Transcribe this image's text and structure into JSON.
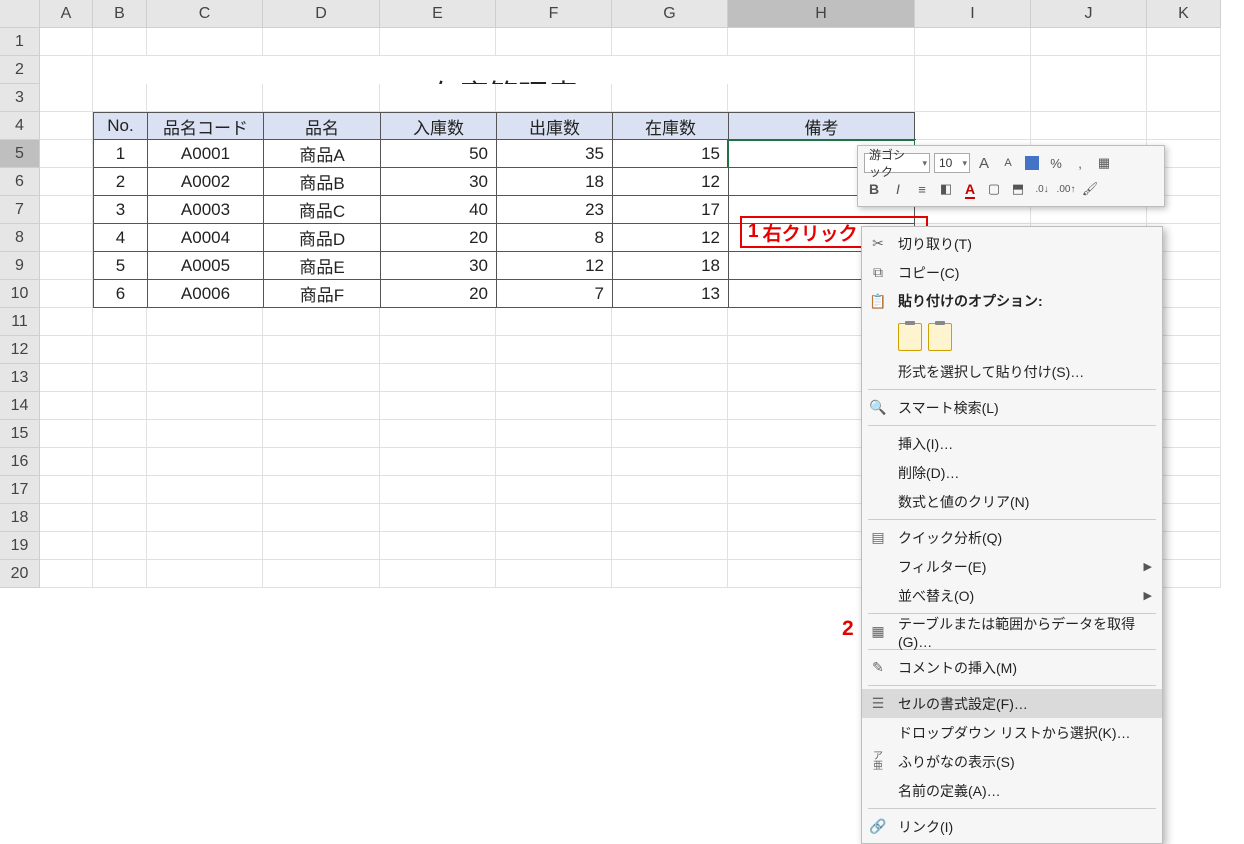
{
  "cols": [
    "A",
    "B",
    "C",
    "D",
    "E",
    "F",
    "G",
    "H",
    "I",
    "J",
    "K"
  ],
  "rows": [
    "1",
    "2",
    "3",
    "4",
    "5",
    "6",
    "7",
    "8",
    "9",
    "10",
    "11",
    "12",
    "13",
    "14",
    "15",
    "16",
    "17",
    "18",
    "19",
    "20"
  ],
  "title": "在庫管理表",
  "activeCol": "H",
  "activeRow": "5",
  "tableHeaders": [
    "No.",
    "品名コード",
    "品名",
    "入庫数",
    "出庫数",
    "在庫数",
    "備考"
  ],
  "tableRows": [
    {
      "no": "1",
      "code": "A0001",
      "name": "商品A",
      "in": "50",
      "out": "35",
      "stock": "15",
      "note": ""
    },
    {
      "no": "2",
      "code": "A0002",
      "name": "商品B",
      "in": "30",
      "out": "18",
      "stock": "12",
      "note": ""
    },
    {
      "no": "3",
      "code": "A0003",
      "name": "商品C",
      "in": "40",
      "out": "23",
      "stock": "17",
      "note": ""
    },
    {
      "no": "4",
      "code": "A0004",
      "name": "商品D",
      "in": "20",
      "out": "8",
      "stock": "12",
      "note": ""
    },
    {
      "no": "5",
      "code": "A0005",
      "name": "商品E",
      "in": "30",
      "out": "12",
      "stock": "18",
      "note": ""
    },
    {
      "no": "6",
      "code": "A0006",
      "name": "商品F",
      "in": "20",
      "out": "7",
      "stock": "13",
      "note": ""
    }
  ],
  "anno1_num": "1",
  "anno1_text": "右クリック",
  "anno2_num": "2",
  "miniToolbar": {
    "font": "游ゴシック",
    "size": "10",
    "increaseA": "A",
    "decreaseA": "A",
    "percent": "%",
    "comma": ",",
    "bold": "B",
    "italic": "I",
    "decInc": ".0",
    "decDec": ".00"
  },
  "ctx": {
    "cut": "切り取り(T)",
    "copy": "コピー(C)",
    "pasteOpts": "貼り付けのオプション:",
    "pasteSpecial": "形式を選択して貼り付け(S)…",
    "smartLookup": "スマート検索(L)",
    "insert": "挿入(I)…",
    "delete": "削除(D)…",
    "clear": "数式と値のクリア(N)",
    "quick": "クイック分析(Q)",
    "filter": "フィルター(E)",
    "sort": "並べ替え(O)",
    "tableData": "テーブルまたは範囲からデータを取得(G)…",
    "insertComment": "コメントの挿入(M)",
    "formatCells": "セルの書式設定(F)…",
    "dropdown": "ドロップダウン リストから選択(K)…",
    "furigana": "ふりがなの表示(S)",
    "defineName": "名前の定義(A)…",
    "link": "リンク(I)"
  }
}
